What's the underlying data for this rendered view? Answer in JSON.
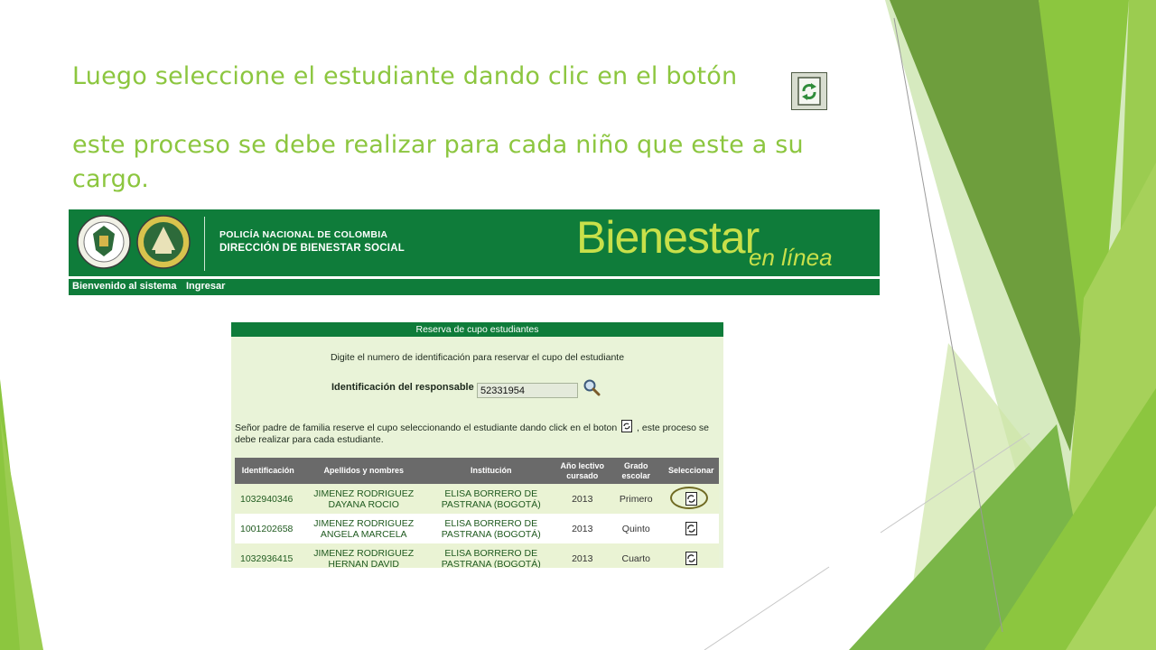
{
  "slide": {
    "line1": "Luego seleccione el estudiante dando clic en el botón",
    "line2": "este proceso se debe realizar para cada niño que este a su",
    "line3": "cargo.",
    "accent_color": "#8cc63f"
  },
  "portal": {
    "org_line1": "POLICÍA NACIONAL DE COLOMBIA",
    "org_line2": "DIRECCIÓN DE BIENESTAR SOCIAL",
    "brand": "Bienestar",
    "brand_sub": "en línea",
    "nav": [
      "Bienvenido al sistema",
      "Ingresar"
    ],
    "primary_color": "#0f7c3a",
    "brand_color": "#c8e04a"
  },
  "form": {
    "title": "Reserva de cupo estudiantes",
    "instruction": "Digite el numero de identificación para reservar el cupo del estudiante",
    "responsible_label": "Identificación del responsable",
    "responsible_value": "52331954",
    "note_part1": "Señor padre de familia reserve el cupo seleccionando el estudiante dando click en el boton",
    "note_part2": ", este proceso se debe realizar para cada estudiante."
  },
  "table": {
    "headers": [
      "Identificación",
      "Apellidos y nombres",
      "Institución",
      "Año lectivo cursado",
      "Grado escolar",
      "Seleccionar"
    ],
    "rows": [
      {
        "id": "1032940346",
        "name": "JIMENEZ RODRIGUEZ DAYANA ROCIO",
        "institution": "ELISA BORRERO DE PASTRANA (BOGOTÁ)",
        "year": "2013",
        "grade": "Primero"
      },
      {
        "id": "1001202658",
        "name": "JIMENEZ RODRIGUEZ ANGELA MARCELA",
        "institution": "ELISA BORRERO DE PASTRANA (BOGOTÁ)",
        "year": "2013",
        "grade": "Quinto"
      },
      {
        "id": "1032936415",
        "name": "JIMENEZ RODRIGUEZ HERNAN DAVID",
        "institution": "ELISA BORRERO DE PASTRANA (BOGOTÁ)",
        "year": "2013",
        "grade": "Cuarto"
      }
    ]
  },
  "icons": {
    "title_icon": "refresh-select-icon",
    "search": "magnifier-icon",
    "select": "select-student-icon"
  }
}
